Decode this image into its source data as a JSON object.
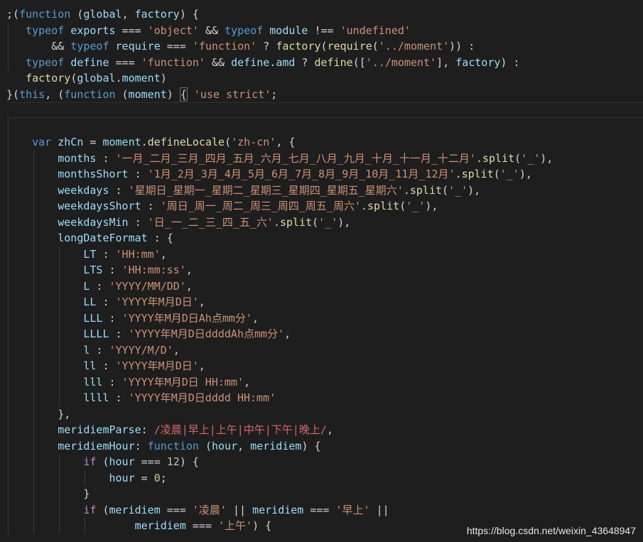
{
  "editor": {
    "lines": [
      [
        [
          "p",
          ";("
        ],
        [
          "k",
          "function"
        ],
        [
          "p",
          " ("
        ],
        [
          "v",
          "global"
        ],
        [
          "p",
          ", "
        ],
        [
          "v",
          "factory"
        ],
        [
          "p",
          ") {"
        ]
      ],
      [
        [
          "p",
          "   "
        ],
        [
          "k",
          "typeof"
        ],
        [
          "p",
          " "
        ],
        [
          "v",
          "exports"
        ],
        [
          "p",
          " === "
        ],
        [
          "s",
          "'object'"
        ],
        [
          "p",
          " && "
        ],
        [
          "k",
          "typeof"
        ],
        [
          "p",
          " "
        ],
        [
          "v",
          "module"
        ],
        [
          "p",
          " !== "
        ],
        [
          "s",
          "'undefined'"
        ]
      ],
      [
        [
          "p",
          "       && "
        ],
        [
          "k",
          "typeof"
        ],
        [
          "p",
          " "
        ],
        [
          "v",
          "require"
        ],
        [
          "p",
          " === "
        ],
        [
          "s",
          "'function'"
        ],
        [
          "p",
          " ? "
        ],
        [
          "f",
          "factory"
        ],
        [
          "p",
          "("
        ],
        [
          "f",
          "require"
        ],
        [
          "p",
          "("
        ],
        [
          "s",
          "'../moment'"
        ],
        [
          "p",
          ")) :"
        ]
      ],
      [
        [
          "p",
          "   "
        ],
        [
          "k",
          "typeof"
        ],
        [
          "p",
          " "
        ],
        [
          "v",
          "define"
        ],
        [
          "p",
          " === "
        ],
        [
          "s",
          "'function'"
        ],
        [
          "p",
          " && "
        ],
        [
          "v",
          "define"
        ],
        [
          "p",
          "."
        ],
        [
          "v",
          "amd"
        ],
        [
          "p",
          " ? "
        ],
        [
          "f",
          "define"
        ],
        [
          "p",
          "(["
        ],
        [
          "s",
          "'../moment'"
        ],
        [
          "p",
          "], "
        ],
        [
          "v",
          "factory"
        ],
        [
          "p",
          ") :"
        ]
      ],
      [
        [
          "p",
          "   "
        ],
        [
          "f",
          "factory"
        ],
        [
          "p",
          "("
        ],
        [
          "v",
          "global"
        ],
        [
          "p",
          "."
        ],
        [
          "v",
          "moment"
        ],
        [
          "p",
          ")"
        ]
      ],
      [
        [
          "p",
          "}("
        ],
        [
          "k",
          "this"
        ],
        [
          "p",
          ", ("
        ],
        [
          "k",
          "function"
        ],
        [
          "p",
          " ("
        ],
        [
          "v",
          "moment"
        ],
        [
          "p",
          ") "
        ],
        [
          "x",
          "{"
        ],
        [
          "p",
          " "
        ],
        [
          "s",
          "'use strict'"
        ],
        [
          "p",
          ";"
        ]
      ],
      [],
      [],
      [
        [
          "p",
          "    "
        ],
        [
          "k",
          "var"
        ],
        [
          "p",
          " "
        ],
        [
          "v",
          "zhCn"
        ],
        [
          "p",
          " = "
        ],
        [
          "v",
          "moment"
        ],
        [
          "p",
          "."
        ],
        [
          "f",
          "defineLocale"
        ],
        [
          "p",
          "("
        ],
        [
          "s",
          "'zh-cn'"
        ],
        [
          "p",
          ", {"
        ]
      ],
      [
        [
          "p",
          "        "
        ],
        [
          "v",
          "months"
        ],
        [
          "p",
          " : "
        ],
        [
          "s",
          "'一月_二月_三月_四月_五月_六月_七月_八月_九月_十月_十一月_十二月'"
        ],
        [
          "p",
          "."
        ],
        [
          "f",
          "split"
        ],
        [
          "p",
          "("
        ],
        [
          "s",
          "'_'"
        ],
        [
          "p",
          "),"
        ]
      ],
      [
        [
          "p",
          "        "
        ],
        [
          "v",
          "monthsShort"
        ],
        [
          "p",
          " : "
        ],
        [
          "s",
          "'1月_2月_3月_4月_5月_6月_7月_8月_9月_10月_11月_12月'"
        ],
        [
          "p",
          "."
        ],
        [
          "f",
          "split"
        ],
        [
          "p",
          "("
        ],
        [
          "s",
          "'_'"
        ],
        [
          "p",
          "),"
        ]
      ],
      [
        [
          "p",
          "        "
        ],
        [
          "v",
          "weekdays"
        ],
        [
          "p",
          " : "
        ],
        [
          "s",
          "'星期日_星期一_星期二_星期三_星期四_星期五_星期六'"
        ],
        [
          "p",
          "."
        ],
        [
          "f",
          "split"
        ],
        [
          "p",
          "("
        ],
        [
          "s",
          "'_'"
        ],
        [
          "p",
          "),"
        ]
      ],
      [
        [
          "p",
          "        "
        ],
        [
          "v",
          "weekdaysShort"
        ],
        [
          "p",
          " : "
        ],
        [
          "s",
          "'周日_周一_周二_周三_周四_周五_周六'"
        ],
        [
          "p",
          "."
        ],
        [
          "f",
          "split"
        ],
        [
          "p",
          "("
        ],
        [
          "s",
          "'_'"
        ],
        [
          "p",
          "),"
        ]
      ],
      [
        [
          "p",
          "        "
        ],
        [
          "v",
          "weekdaysMin"
        ],
        [
          "p",
          " : "
        ],
        [
          "s",
          "'日_一_二_三_四_五_六'"
        ],
        [
          "p",
          "."
        ],
        [
          "f",
          "split"
        ],
        [
          "p",
          "("
        ],
        [
          "s",
          "'_'"
        ],
        [
          "p",
          "),"
        ]
      ],
      [
        [
          "p",
          "        "
        ],
        [
          "v",
          "longDateFormat"
        ],
        [
          "p",
          " : {"
        ]
      ],
      [
        [
          "p",
          "            "
        ],
        [
          "v",
          "LT"
        ],
        [
          "p",
          " : "
        ],
        [
          "s",
          "'HH:mm'"
        ],
        [
          "p",
          ","
        ]
      ],
      [
        [
          "p",
          "            "
        ],
        [
          "v",
          "LTS"
        ],
        [
          "p",
          " : "
        ],
        [
          "s",
          "'HH:mm:ss'"
        ],
        [
          "p",
          ","
        ]
      ],
      [
        [
          "p",
          "            "
        ],
        [
          "v",
          "L"
        ],
        [
          "p",
          " : "
        ],
        [
          "s",
          "'YYYY/MM/DD'"
        ],
        [
          "p",
          ","
        ]
      ],
      [
        [
          "p",
          "            "
        ],
        [
          "v",
          "LL"
        ],
        [
          "p",
          " : "
        ],
        [
          "s",
          "'YYYY年M月D日'"
        ],
        [
          "p",
          ","
        ]
      ],
      [
        [
          "p",
          "            "
        ],
        [
          "v",
          "LLL"
        ],
        [
          "p",
          " : "
        ],
        [
          "s",
          "'YYYY年M月D日Ah点mm分'"
        ],
        [
          "p",
          ","
        ]
      ],
      [
        [
          "p",
          "            "
        ],
        [
          "v",
          "LLLL"
        ],
        [
          "p",
          " : "
        ],
        [
          "s",
          "'YYYY年M月D日ddddAh点mm分'"
        ],
        [
          "p",
          ","
        ]
      ],
      [
        [
          "p",
          "            "
        ],
        [
          "v",
          "l"
        ],
        [
          "p",
          " : "
        ],
        [
          "s",
          "'YYYY/M/D'"
        ],
        [
          "p",
          ","
        ]
      ],
      [
        [
          "p",
          "            "
        ],
        [
          "v",
          "ll"
        ],
        [
          "p",
          " : "
        ],
        [
          "s",
          "'YYYY年M月D日'"
        ],
        [
          "p",
          ","
        ]
      ],
      [
        [
          "p",
          "            "
        ],
        [
          "v",
          "lll"
        ],
        [
          "p",
          " : "
        ],
        [
          "s",
          "'YYYY年M月D日 HH:mm'"
        ],
        [
          "p",
          ","
        ]
      ],
      [
        [
          "p",
          "            "
        ],
        [
          "v",
          "llll"
        ],
        [
          "p",
          " : "
        ],
        [
          "s",
          "'YYYY年M月D日dddd HH:mm'"
        ]
      ],
      [
        [
          "p",
          "        },"
        ]
      ],
      [
        [
          "p",
          "        "
        ],
        [
          "v",
          "meridiemParse"
        ],
        [
          "p",
          ": "
        ],
        [
          "r",
          "/凌晨|早上|上午|中午|下午|晚上/"
        ],
        [
          "p",
          ","
        ]
      ],
      [
        [
          "p",
          "        "
        ],
        [
          "v",
          "meridiemHour"
        ],
        [
          "p",
          ": "
        ],
        [
          "k",
          "function"
        ],
        [
          "p",
          " ("
        ],
        [
          "v",
          "hour"
        ],
        [
          "p",
          ", "
        ],
        [
          "v",
          "meridiem"
        ],
        [
          "p",
          ") {"
        ]
      ],
      [
        [
          "p",
          "            "
        ],
        [
          "c",
          "if"
        ],
        [
          "p",
          " ("
        ],
        [
          "v",
          "hour"
        ],
        [
          "p",
          " === "
        ],
        [
          "n",
          "12"
        ],
        [
          "p",
          ") {"
        ]
      ],
      [
        [
          "p",
          "                "
        ],
        [
          "v",
          "hour"
        ],
        [
          "p",
          " = "
        ],
        [
          "n",
          "0"
        ],
        [
          "p",
          ";"
        ]
      ],
      [
        [
          "p",
          "            }"
        ]
      ],
      [
        [
          "p",
          "            "
        ],
        [
          "c",
          "if"
        ],
        [
          "p",
          " ("
        ],
        [
          "v",
          "meridiem"
        ],
        [
          "p",
          " === "
        ],
        [
          "s",
          "'凌晨'"
        ],
        [
          "p",
          " || "
        ],
        [
          "v",
          "meridiem"
        ],
        [
          "p",
          " === "
        ],
        [
          "s",
          "'早上'"
        ],
        [
          "p",
          " ||"
        ]
      ],
      [
        [
          "p",
          "                    "
        ],
        [
          "v",
          "meridiem"
        ],
        [
          "p",
          " === "
        ],
        [
          "s",
          "'上午'"
        ],
        [
          "p",
          ") {"
        ]
      ]
    ]
  },
  "watermark": "https://blog.csdn.net/weixin_43648947"
}
